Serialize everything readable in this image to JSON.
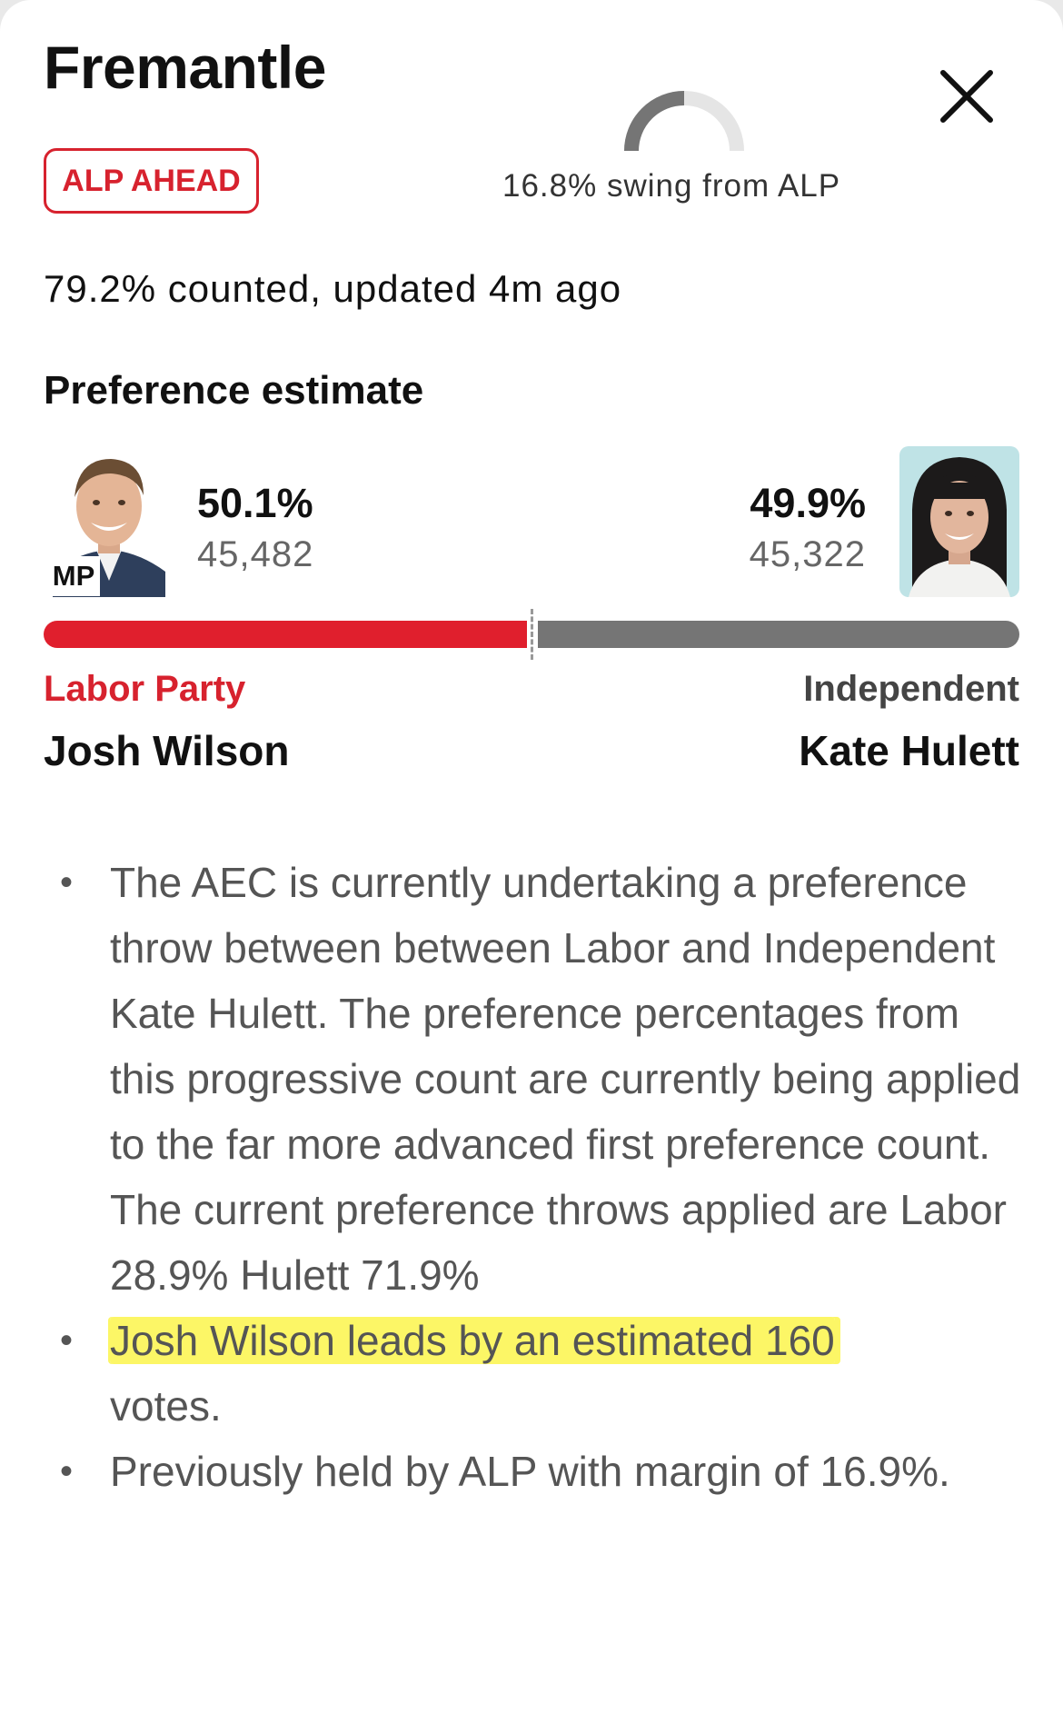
{
  "electorate": {
    "name": "Fremantle"
  },
  "status_badge": "ALP AHEAD",
  "swing": {
    "text": "16.8% swing from ALP",
    "percent": 16.8,
    "gauge_color": "#757575"
  },
  "counted_text": "79.2% counted, updated 4m ago",
  "preference": {
    "title": "Preference estimate",
    "left": {
      "pct": "50.1%",
      "share": 50.1,
      "votes": "45,482",
      "party": "Labor Party",
      "name": "Josh Wilson",
      "tag": "MP",
      "color": "#e01f2d"
    },
    "right": {
      "pct": "49.9%",
      "share": 49.9,
      "votes": "45,322",
      "party": "Independent",
      "name": "Kate Hulett",
      "color": "#757575"
    }
  },
  "notes": [
    "The AEC is currently undertaking a preference throw between between Labor and Independent Kate Hulett. The preference percentages from this progressive count are currently being applied to the far more advanced first preference count. The current preference throws applied are Labor 28.9% Hulett 71.9%",
    "Josh Wilson leads by an estimated 160",
    "votes.",
    "Previously held by ALP with margin of 16.9%."
  ],
  "icons": {
    "close": "close-icon",
    "gauge": "swing-gauge-icon"
  }
}
